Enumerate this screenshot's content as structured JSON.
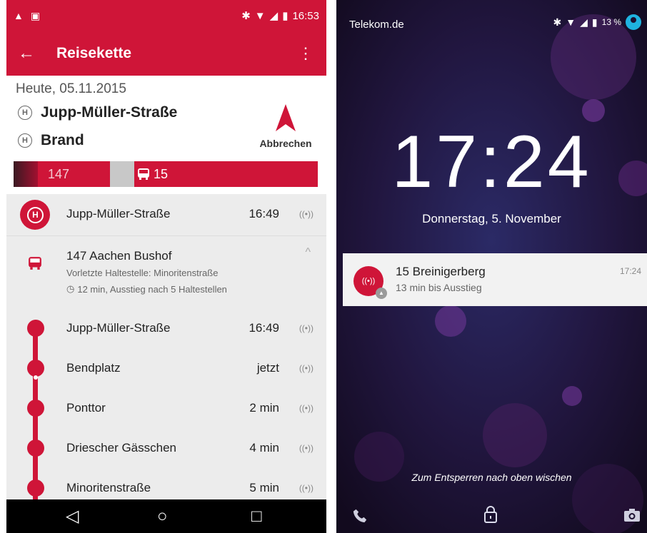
{
  "left": {
    "status": {
      "time": "16:53"
    },
    "appbar": {
      "title": "Reisekette"
    },
    "header": {
      "date": "Heute, 05.11.2015",
      "from": "Jupp-Müller-Straße",
      "to": "Brand",
      "cancel": "Abbrechen",
      "hmark": "H"
    },
    "legbar": {
      "leg1": "147",
      "leg2": "15"
    },
    "first_stop": {
      "name": "Jupp-Müller-Straße",
      "time": "16:49"
    },
    "leg": {
      "title": "147 Aachen Bushof",
      "sub": "Vorletzte Haltestelle: Minoritenstraße",
      "info": "12 min, Ausstieg nach 5 Haltestellen"
    },
    "stops": [
      {
        "name": "Jupp-Müller-Straße",
        "time": "16:49"
      },
      {
        "name": "Bendplatz",
        "time": "jetzt"
      },
      {
        "name": "Ponttor",
        "time": "2 min"
      },
      {
        "name": "Driescher Gässchen",
        "time": "4 min"
      },
      {
        "name": "Minoritenstraße",
        "time": "5 min"
      }
    ],
    "signal": "((•))"
  },
  "right": {
    "carrier": "Telekom.de",
    "battery": "13 %",
    "clock": "17:24",
    "date": "Donnerstag, 5. November",
    "notification": {
      "title": "15 Breinigerberg",
      "sub": "13 min bis Ausstieg",
      "time": "17:24"
    },
    "unlock": "Zum Entsperren nach oben wischen"
  },
  "colors": {
    "accent": "#cf1538",
    "bg": "#ececec"
  }
}
